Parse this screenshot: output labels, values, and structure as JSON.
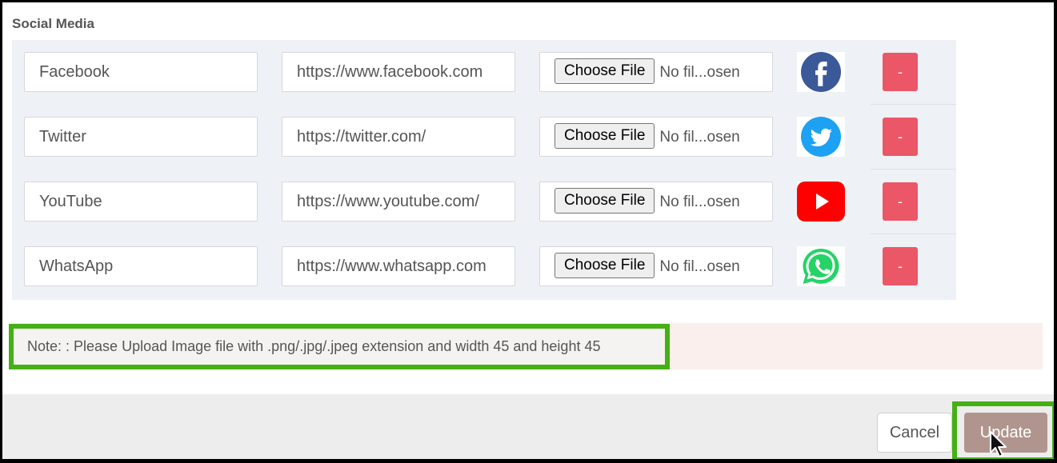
{
  "section": {
    "title": "Social Media"
  },
  "rows": [
    {
      "name": "Facebook",
      "url": "https://www.facebook.com",
      "choose_label": "Choose File",
      "file_status": "No fil...osen",
      "icon": "facebook-icon",
      "remove_label": "-"
    },
    {
      "name": "Twitter",
      "url": "https://twitter.com/",
      "choose_label": "Choose File",
      "file_status": "No fil...osen",
      "icon": "twitter-icon",
      "remove_label": "-"
    },
    {
      "name": "YouTube",
      "url": "https://www.youtube.com/",
      "choose_label": "Choose File",
      "file_status": "No fil...osen",
      "icon": "youtube-icon",
      "remove_label": "-"
    },
    {
      "name": "WhatsApp",
      "url": "https://www.whatsapp.com",
      "choose_label": "Choose File",
      "file_status": "No fil...osen",
      "icon": "whatsapp-icon",
      "remove_label": "-"
    }
  ],
  "note": {
    "text": "Note: : Please Upload Image file with .png/.jpg/.jpeg extension and width 45 and height 45"
  },
  "footer": {
    "cancel_label": "Cancel",
    "update_label": "Update"
  },
  "colors": {
    "highlight": "#45b015",
    "remove_button": "#eb5766",
    "update_button": "#b0958e",
    "facebook": "#3b5998",
    "twitter": "#1da1f2",
    "youtube": "#ff0000",
    "whatsapp": "#25d366"
  }
}
